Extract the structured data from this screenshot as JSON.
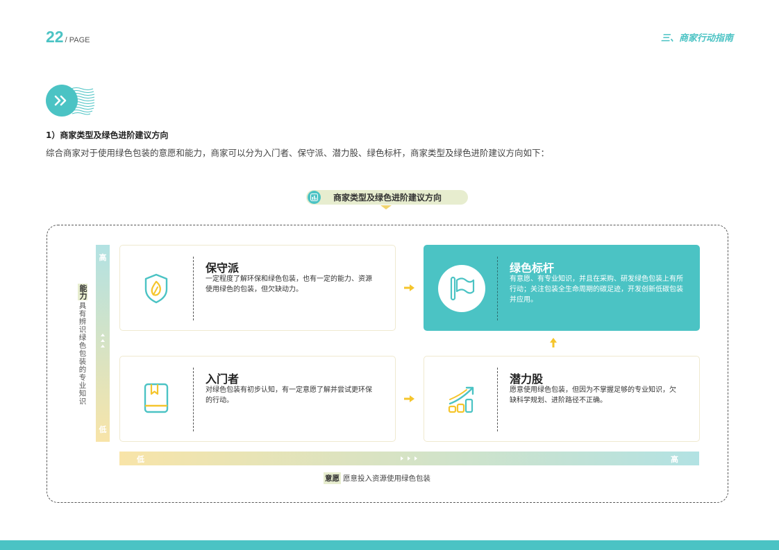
{
  "header": {
    "page_number": "22",
    "page_label": "/ PAGE",
    "section_title": "三、商家行动指南"
  },
  "heading": "1）商家类型及绿色进阶建议方向",
  "paragraph": "综合商家对于使用绿色包装的意愿和能力，商家可以分为入门者、保守派、潜力股、绿色标杆，商家类型及绿色进阶建议方向如下：",
  "diagram": {
    "title": "商家类型及绿色进阶建议方向",
    "y_axis": {
      "tag": "能力",
      "label": "具有辨识绿色包装的专业知识",
      "high": "高",
      "low": "低"
    },
    "x_axis": {
      "tag": "意愿",
      "label": "愿意投入资源使用绿色包装",
      "high": "高",
      "low": "低"
    },
    "cards": {
      "conservative": {
        "title": "保守派",
        "desc": "一定程度了解环保和绿色包装，也有一定的能力、资源使用绿色的包装，但欠缺动力。",
        "icon": "leaf-shield-icon"
      },
      "benchmark": {
        "title": "绿色标杆",
        "desc": "有意愿、有专业知识，并且在采购、研发绿色包装上有所行动；关注包装全生命周期的碳足迹，开发创新低碳包装并应用。",
        "icon": "flag-icon"
      },
      "beginner": {
        "title": "入门者",
        "desc": "对绿色包装有初步认知，有一定意愿了解并尝试更环保的行动。",
        "icon": "book-icon"
      },
      "potential": {
        "title": "潜力股",
        "desc": "愿意使用绿色包装，但因为不掌握足够的专业知识，欠缺科学规划、进阶路径不正确。",
        "icon": "growth-chart-icon"
      }
    }
  },
  "colors": {
    "teal": "#4bc3c4",
    "yellow": "#f5c52c",
    "pale_green": "#e7edcf"
  }
}
